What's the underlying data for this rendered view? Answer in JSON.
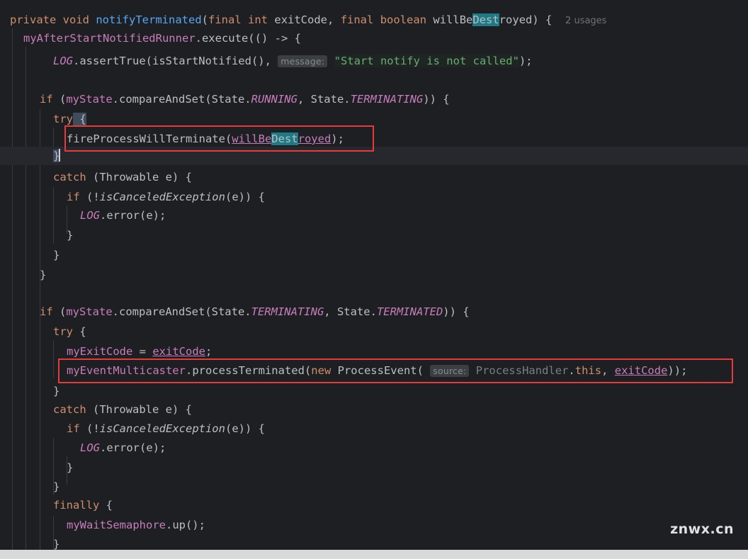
{
  "editor": {
    "language": "java",
    "theme": "IntelliJ Dark",
    "background": "#1E1F22",
    "default_text_color": "#BCBEC4",
    "inlay_hint_background": "#3C3F41",
    "match_highlight_color": "#1E7A85",
    "annotation_box_color": "#E8393B",
    "current_line_band_color": "#26282E"
  },
  "code": {
    "line_1": {
      "kw_private": "private",
      "kw_void": "void",
      "method_name": "notifyTerminated",
      "paren_open": "(",
      "kw_final_1": "final",
      "kw_int": "int",
      "param_exitCode": "exitCode",
      "comma": ", ",
      "kw_final_2": "final",
      "kw_boolean": "boolean",
      "param_willBe": "willBe",
      "param_match": "Dest",
      "param_royed": "royed",
      "tail": ") {",
      "usages_hint": "2 usages"
    },
    "line_2": {
      "receiver": "myAfterStartNotifiedRunner",
      "rest": ".execute(() -> {"
    },
    "line_3": {
      "log": "LOG",
      "call": ".assertTrue(isStartNotified(), ",
      "hint": "message:",
      "string": "\"Start notify is not called\"",
      "tail": ");"
    },
    "line_5": {
      "kw_if": "if",
      "open": " (",
      "field": "myState",
      "method": ".compareAndSet(State.",
      "const_1": "RUNNING",
      "mid": ", State.",
      "const_2": "TERMINATING",
      "tail": ")) {"
    },
    "line_6": {
      "kw_try": "try",
      "brace": " {"
    },
    "line_7": {
      "call": "fireProcessWillTerminate(",
      "arg_pre": "willBe",
      "arg_match": "Dest",
      "arg_post": "royed",
      "tail": ");"
    },
    "line_8": {
      "brace": "}"
    },
    "line_9": {
      "kw_catch": "catch",
      "rest": " (Throwable e) {"
    },
    "line_10": {
      "kw_if": "if",
      "open": " (!",
      "method": "isCanceledException",
      "tail": "(e)) {"
    },
    "line_11": {
      "log": "LOG",
      "rest": ".error(e);"
    },
    "line_12": {
      "brace": "}"
    },
    "line_13": {
      "brace": "}"
    },
    "line_14": {
      "brace": "}"
    },
    "line_16": {
      "kw_if": "if",
      "open": " (",
      "field": "myState",
      "method": ".compareAndSet(State.",
      "const_1": "TERMINATING",
      "mid": ", State.",
      "const_2": "TERMINATED",
      "tail": ")) {"
    },
    "line_17": {
      "kw_try": "try",
      "brace": " {"
    },
    "line_18": {
      "field": "myExitCode",
      "eq": " = ",
      "param": "exitCode",
      "tail": ";"
    },
    "line_19": {
      "field": "myEventMulticaster",
      "call": ".processTerminated(",
      "kw_new": "new",
      "type": " ProcessEvent(",
      "hint": "source:",
      "qualifier": "ProcessHandler",
      "dot": ".",
      "kw_this": "this",
      "comma": ", ",
      "param": "exitCode",
      "tail": "));"
    },
    "line_20": {
      "brace": "}"
    },
    "line_21": {
      "kw_catch": "catch",
      "rest": " (Throwable e) {"
    },
    "line_22": {
      "kw_if": "if",
      "open": " (!",
      "method": "isCanceledException",
      "tail": "(e)) {"
    },
    "line_23": {
      "log": "LOG",
      "rest": ".error(e);"
    },
    "line_24": {
      "brace": "}"
    },
    "line_25": {
      "brace": "}"
    },
    "line_26": {
      "kw_finally": "finally",
      "brace": " {"
    },
    "line_27": {
      "field": "myWaitSemaphore",
      "rest": ".up();"
    },
    "line_28": {
      "brace": "}"
    }
  },
  "annotations": {
    "box_1_target": "fireProcessWillTerminate(willBeDestroyed);",
    "box_2_target": "myEventMulticaster.processTerminated(new ProcessEvent(ProcessHandler.this, exitCode));"
  },
  "watermark": {
    "text": "znwx.cn"
  }
}
